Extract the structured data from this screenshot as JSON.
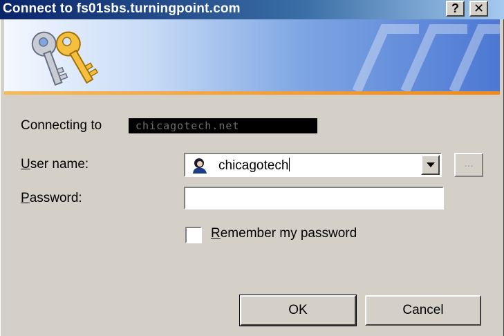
{
  "window": {
    "title": "Connect to fs01sbs.turningpoint.com",
    "help_label": "?",
    "close_label": "✕"
  },
  "connecting": {
    "label": "Connecting to",
    "server_redacted": "chicagotech.net"
  },
  "username": {
    "label_accel": "U",
    "label_rest": "ser name:",
    "value": "chicagotech",
    "browse_label": "..."
  },
  "password": {
    "label_accel": "P",
    "label_rest": "assword:",
    "value": ""
  },
  "remember": {
    "label_accel": "R",
    "label_rest": "emember my password",
    "checked": false
  },
  "buttons": {
    "ok": "OK",
    "cancel": "Cancel"
  },
  "colors": {
    "titlebar_start": "#0a246a",
    "dialog_bg": "#d4d0c8",
    "banner_accent": "#f08a1a"
  },
  "icons": {
    "banner": "keys-icon",
    "user": "user-icon",
    "dropdown": "chevron-down-icon"
  }
}
